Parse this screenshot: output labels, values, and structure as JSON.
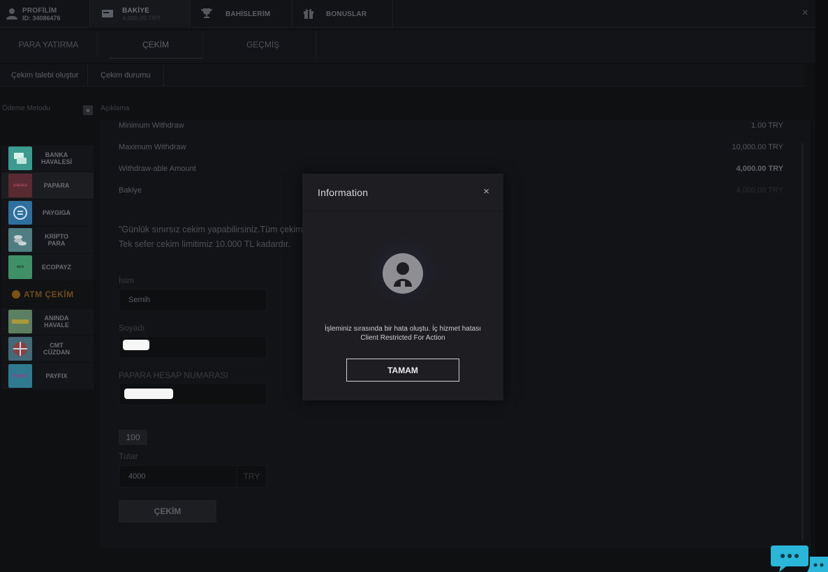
{
  "topnav": {
    "profile": {
      "label": "PROFİLİM",
      "id_line": "ID: 34086476"
    },
    "balance": {
      "label": "BAKİYE",
      "value": "4.000,00 TRY"
    },
    "bets": {
      "label": "BAHİSLERİM"
    },
    "bonuses": {
      "label": "BONUSLAR"
    },
    "close": "×"
  },
  "subtabs": [
    "PARA YATIRMA",
    "ÇEKİM",
    "GEÇMİŞ"
  ],
  "subsub": [
    "Çekim talebi oluştur",
    "Çekim durumu"
  ],
  "left": {
    "header_method": "Ödeme Metodu",
    "header_desc": "Açıklama",
    "collapse": "«",
    "methods": [
      {
        "label": "BANKA HAVALESİ",
        "logo": ""
      },
      {
        "label": "PAPARA",
        "logo": "papara"
      },
      {
        "label": "PAYGIGA",
        "logo": ""
      },
      {
        "label": "KRİPTO PARA",
        "logo": ""
      },
      {
        "label": "ECOPAYZ",
        "logo": "eco"
      },
      {
        "label": "ATM ÇEKİM",
        "logo": ""
      },
      {
        "label": "ANINDA HAVALE",
        "logo": ""
      },
      {
        "label": "CMT CÜZDAN",
        "logo": ""
      },
      {
        "label": "PAYFIX",
        "logo": "Payfix"
      }
    ]
  },
  "info": {
    "min_label": "Minimum Withdraw",
    "min_value": "1.00 TRY",
    "max_label": "Maximum Withdraw",
    "max_value": "10,000.00 TRY",
    "able_label": "Withdraw-able Amount",
    "able_value": "4,000.00 TRY",
    "balance_label": "Bakiye",
    "balance_value": "4,000.00 TRY"
  },
  "note": {
    "line1": "\"Günlük sınırsız cekim yapabilirsiniz.Tüm çekim",
    "line2": "Tek sefer cekim limitimiz 10.000 TL kadardır."
  },
  "form": {
    "name_label": "İsim",
    "name_value": "Semih",
    "surname_label": "Soyadı",
    "account_label": "PAPARA HESAP NUMARASI",
    "chip": "100",
    "amount_label": "Tutar",
    "amount_value": "4000",
    "currency": "TRY",
    "submit": "ÇEKİM"
  },
  "modal": {
    "title": "Information",
    "close": "×",
    "message": "İşleminiz sırasında bir hata oluştu. İç hizmet hatası Client Restricted For Action",
    "ok": "TAMAM"
  },
  "colors": {
    "accent": "#29b6d8",
    "modal_bg": "#1d1d22"
  }
}
